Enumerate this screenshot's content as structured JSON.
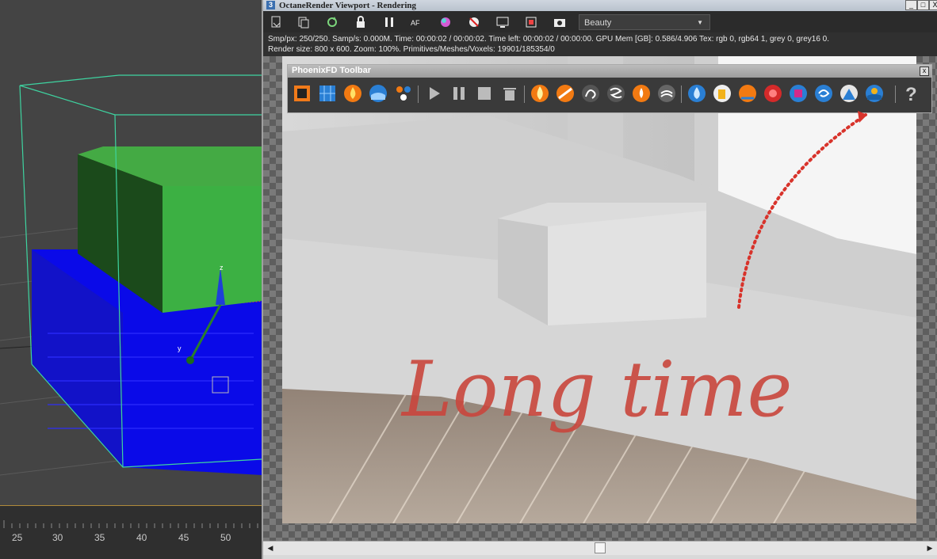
{
  "viewport": {
    "gizmo_z": "z",
    "gizmo_y": "y",
    "ruler_ticks": [
      "25",
      "30",
      "35",
      "40",
      "45",
      "50"
    ]
  },
  "octane": {
    "title": "OctaneRender Viewport - Rendering",
    "title_icon": "3",
    "window_controls": [
      "_",
      "□",
      "X"
    ],
    "toolbar_icons": [
      "save-icon",
      "copy-icon",
      "refresh-icon",
      "lock-icon",
      "pause-icon",
      "focus-icon",
      "color-icon",
      "no-entry-icon",
      "monitor-icon",
      "film-icon",
      "camera-icon"
    ],
    "view_mode": "Beauty",
    "status_line1": "Smp/px: 250/250.   Samp/s: 0.000M.   Time: 00:00:02 / 00:00:02.   Time left: 00:00:02 / 00:00:00.   GPU Mem [GB]: 0.586/4.906   Tex: rgb 0, rgb64 1, grey 0, grey16 0.",
    "status_line2": "Render size: 800 x 600.   Zoom: 100%.   Primitives/Meshes/Voxels: 19901/185354/0"
  },
  "phoenix": {
    "title": "PhoenixFD Toolbar",
    "close_label": "x",
    "icons": [
      "liquid-source-icon",
      "liquid-grid-icon",
      "fire-icon",
      "liquid-icon",
      "particles-icon",
      "play-icon",
      "pause-icon",
      "stop-icon",
      "trash-icon",
      "fire-preset-icon",
      "explosion-icon",
      "smoke-icon",
      "smoke-swirl-icon",
      "candle-icon",
      "steam-icon",
      "water-drop-icon",
      "beer-icon",
      "splash-icon",
      "burst-icon",
      "cube-icon",
      "wave-icon",
      "waterfall-icon",
      "ocean-icon",
      "help-icon"
    ],
    "help_label": "?"
  },
  "annotation": {
    "handwritten_text": "Long time",
    "color": "#c9463d"
  },
  "colors": {
    "max_green": "#3cb043",
    "max_blue": "#1a1aff",
    "annotation_red": "#d8332b"
  }
}
